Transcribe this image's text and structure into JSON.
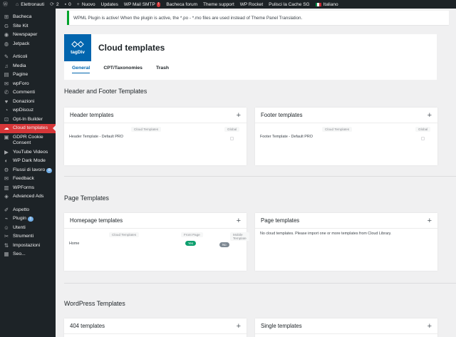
{
  "adminbar": {
    "site_name": "Elettronauti",
    "updates_count": "2",
    "comments_count": "0",
    "new_label": "Nuovo",
    "updates_label": "Updates",
    "mail_label": "WP Mail SMTP",
    "mail_badge": "!",
    "forum_label": "Bacheca forum",
    "theme_support_label": "Theme support",
    "wp_rocket_label": "WP Rocket",
    "cache_label": "Pulisci la Cache SG",
    "language_label": "Italiano"
  },
  "sidebar": {
    "items": [
      {
        "icon": "dashboard-icon",
        "glyph": "⊞",
        "label": "Bacheca"
      },
      {
        "icon": "sitekit-icon",
        "glyph": "G",
        "label": "Site Kit"
      },
      {
        "icon": "newspaper-icon",
        "glyph": "◉",
        "label": "Newspaper"
      },
      {
        "icon": "jetpack-icon",
        "glyph": "◍",
        "label": "Jetpack"
      },
      {
        "icon": "pin-icon",
        "glyph": "✎",
        "label": "Articoli"
      },
      {
        "icon": "media-icon",
        "glyph": "♫",
        "label": "Media"
      },
      {
        "icon": "pages-icon",
        "glyph": "▤",
        "label": "Pagine"
      },
      {
        "icon": "wpforo-icon",
        "glyph": "✉",
        "label": "wpForo"
      },
      {
        "icon": "comments-icon",
        "glyph": "✆",
        "label": "Commenti"
      },
      {
        "icon": "donations-icon",
        "glyph": "♥",
        "label": "Donazioni"
      },
      {
        "icon": "wpdiscuz-icon",
        "glyph": "◔",
        "label": "wpDiscuz"
      },
      {
        "icon": "optin-icon",
        "glyph": "⊡",
        "label": "Opt-In Builder"
      },
      {
        "icon": "cloud-icon",
        "glyph": "☁",
        "label": "Cloud templates"
      },
      {
        "icon": "cookie-icon",
        "glyph": "▣",
        "label": "GDPR Cookie Consent"
      },
      {
        "icon": "youtube-icon",
        "glyph": "▶",
        "label": "YouTube Videos"
      },
      {
        "icon": "darkmode-icon",
        "glyph": "◐",
        "label": "WP Dark Mode"
      },
      {
        "icon": "workflow-icon",
        "glyph": "⚙",
        "label": "Flussi di lavoro",
        "count": "8"
      },
      {
        "icon": "feedback-icon",
        "glyph": "✉",
        "label": "Feedback"
      },
      {
        "icon": "wpforms-icon",
        "glyph": "▥",
        "label": "WPForms"
      },
      {
        "icon": "ads-icon",
        "glyph": "◈",
        "label": "Advanced Ads"
      },
      {
        "icon": "appearance-icon",
        "glyph": "✐",
        "label": "Aspetto"
      },
      {
        "icon": "plugins-icon",
        "glyph": "⌁",
        "label": "Plugin",
        "count": "1"
      },
      {
        "icon": "users-icon",
        "glyph": "☺",
        "label": "Utenti"
      },
      {
        "icon": "tools-icon",
        "glyph": "✂",
        "label": "Strumenti"
      },
      {
        "icon": "settings-icon",
        "glyph": "⇅",
        "label": "Impostazioni"
      },
      {
        "icon": "extra-icon",
        "glyph": "▦",
        "label": "Seo..."
      }
    ]
  },
  "notice": {
    "text": "WPML Plugin is active! When the plugin is active, the *.po - *.mo files are used instead of Theme Panel Translation."
  },
  "header": {
    "logo_text": "tagDiv",
    "title": "Cloud templates",
    "tabs": [
      "General",
      "CPT/Taxonomies",
      "Trash"
    ]
  },
  "sections": {
    "header_footer": "Header and Footer Templates",
    "page": "Page Templates",
    "wordpress": "WordPress Templates"
  },
  "cards": {
    "header": {
      "title": "Header templates",
      "col_cloud": "Cloud Templates",
      "col_global": "Global",
      "row": "Header Template - Default PRO"
    },
    "footer": {
      "title": "Footer templates",
      "col_cloud": "Cloud Templates",
      "col_global": "Global",
      "row": "Footer Template - Default PRO"
    },
    "homepage": {
      "title": "Homepage templates",
      "col_cloud": "Cloud Templates",
      "col_front": "Front Page",
      "col_mobile": "Mobile Template",
      "row": "Home",
      "front_value": "Yes",
      "mobile_value": "No"
    },
    "page": {
      "title": "Page templates",
      "empty": "No cloud templates. Please import one or more templates from Cloud Library."
    },
    "t404": {
      "title": "404 templates"
    },
    "single": {
      "title": "Single templates"
    }
  },
  "colors": {
    "adminbar_bg": "#1d2327",
    "active_menu": "#d63638",
    "brand_blue": "#0165ae",
    "notice_green": "#00a32a",
    "yes_green": "#0d9f6e"
  }
}
